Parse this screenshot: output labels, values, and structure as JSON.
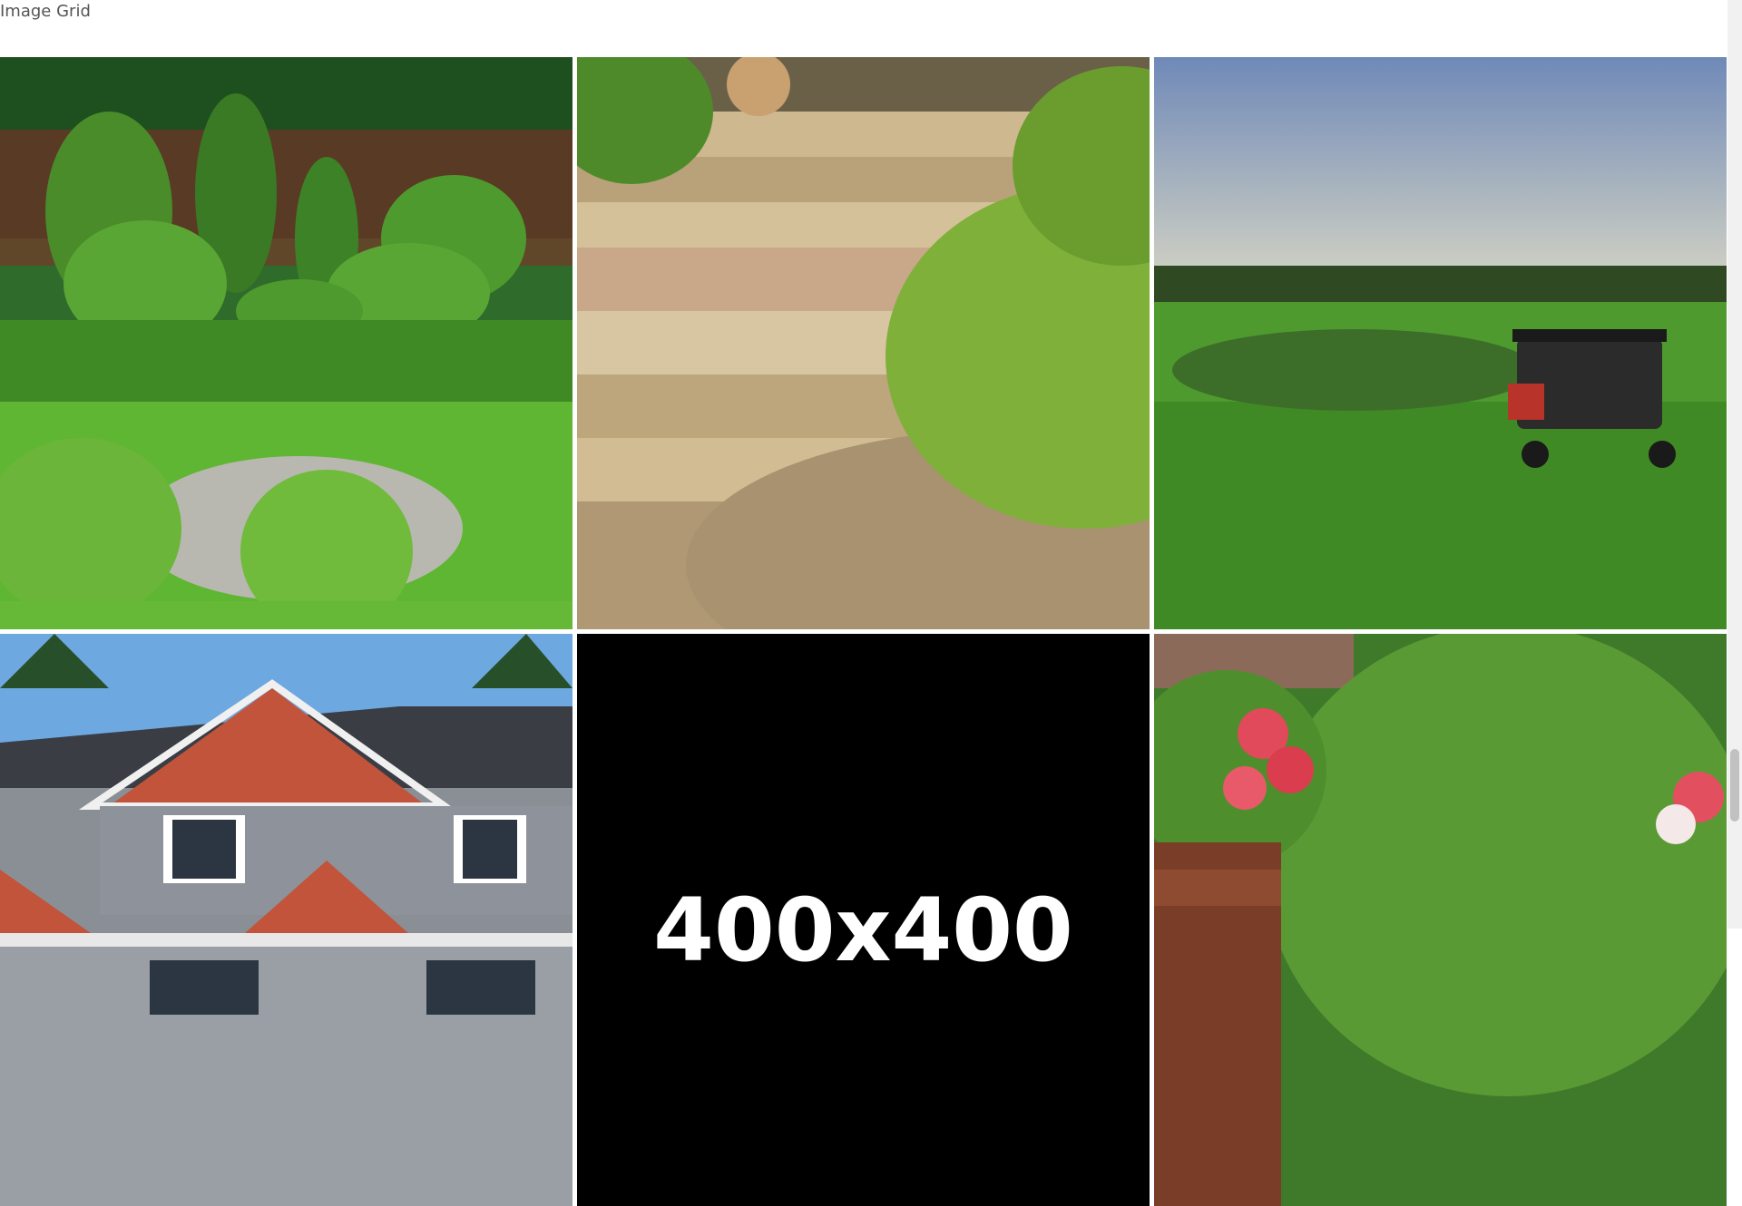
{
  "page": {
    "title": "Image Grid"
  },
  "images": [
    {
      "subject": "Topiary garden with boulder"
    },
    {
      "subject": "Stone garden steps with plants"
    },
    {
      "subject": "Golf course with cart"
    },
    {
      "subject": "Suburban house exterior"
    },
    {
      "subject": "Placeholder",
      "label": "400x400"
    },
    {
      "subject": "Shrub with red flowers"
    }
  ],
  "colors": {
    "placeholder_bg": "#000000",
    "placeholder_text": "#ffffff"
  }
}
